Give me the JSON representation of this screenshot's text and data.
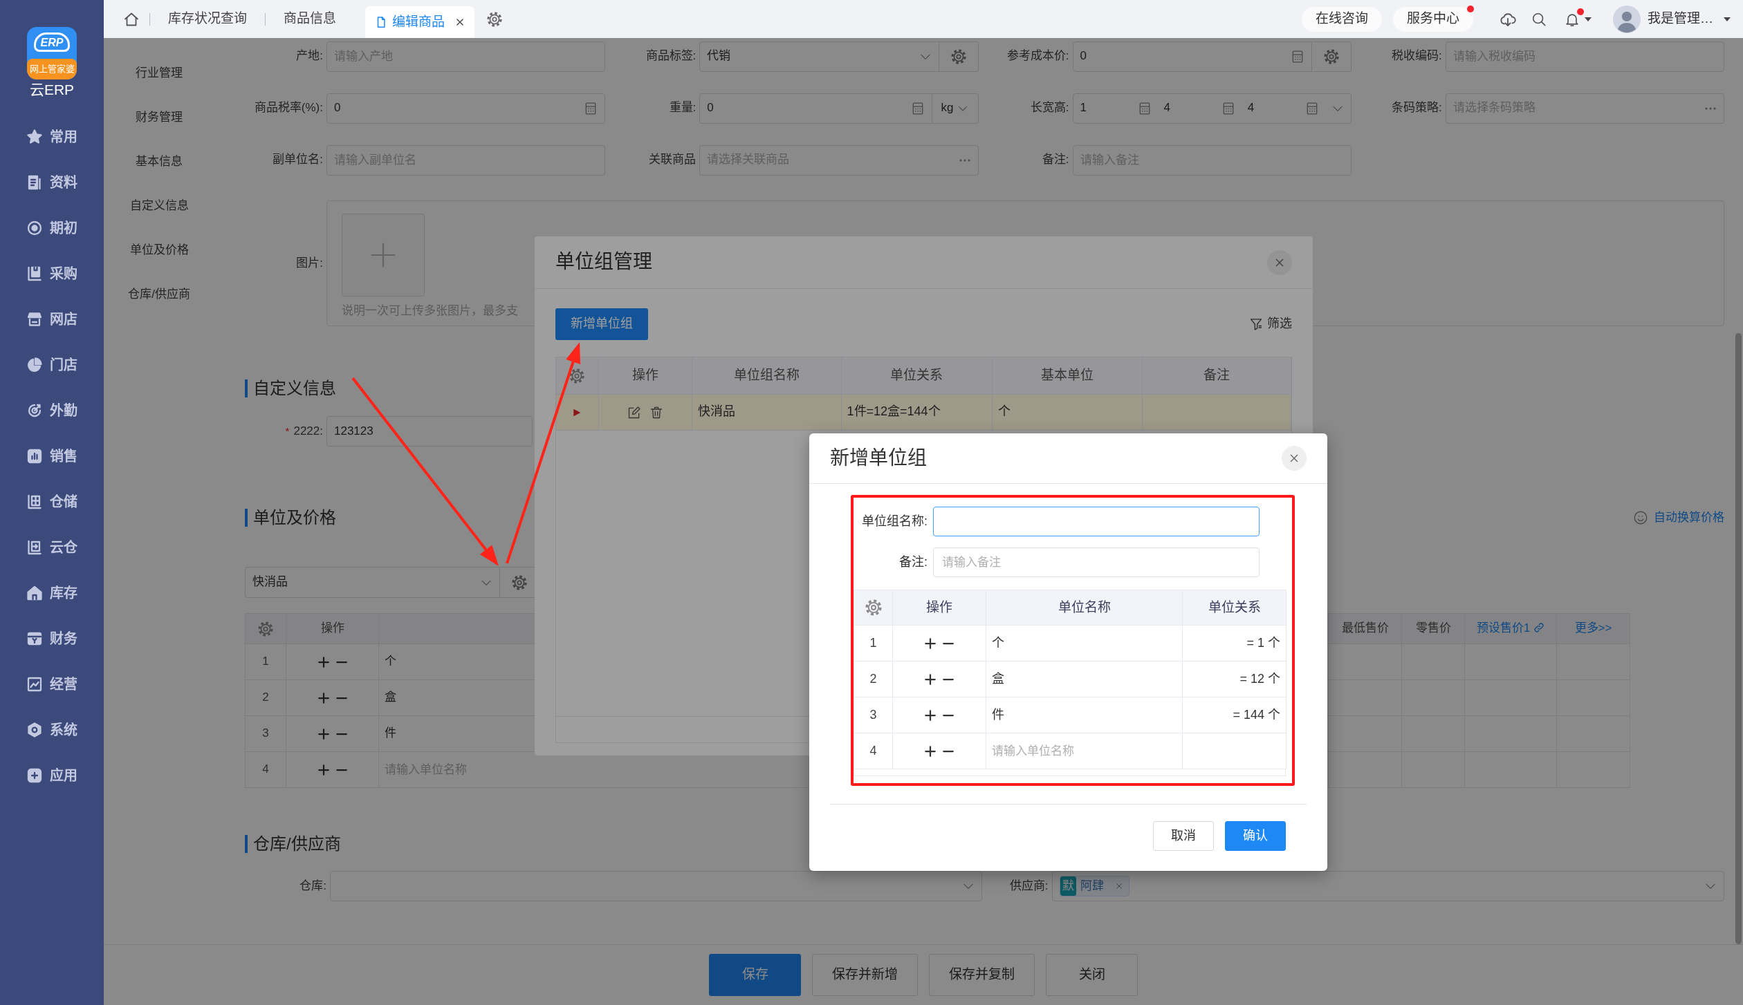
{
  "sidebar": {
    "logo_mark": "ERP",
    "logo_badge": "网上管家婆",
    "brand": "云ERP",
    "items": [
      "常用",
      "资料",
      "期初",
      "采购",
      "网店",
      "门店",
      "外勤",
      "销售",
      "仓储",
      "云仓",
      "库存",
      "财务",
      "经营",
      "系统",
      "应用"
    ]
  },
  "topbar": {
    "tabs": [
      {
        "label": "库存状况查询",
        "selected": false
      },
      {
        "label": "商品信息",
        "selected": false
      },
      {
        "label": "编辑商品",
        "selected": true
      }
    ],
    "actions": [
      {
        "label": "在线咨询",
        "dot": false
      },
      {
        "label": "服务中心",
        "dot": true
      }
    ],
    "bell_dot": true,
    "user_name": "我是管理…"
  },
  "section_nav": [
    "行业管理",
    "财务管理",
    "基本信息",
    "自定义信息",
    "单位及价格",
    "仓库/供应商"
  ],
  "form": {
    "rows": [
      [
        {
          "kind": "text",
          "label": "产地:",
          "placeholder": "请输入产地"
        },
        {
          "kind": "select-config",
          "label": "商品标签:",
          "value": "代销"
        },
        {
          "kind": "number-config",
          "label": "参考成本价:",
          "value": "0"
        },
        {
          "kind": "text",
          "label": "税收编码:",
          "placeholder": "请输入税收编码"
        }
      ],
      [
        {
          "kind": "number",
          "label": "商品税率(%):",
          "value": "0"
        },
        {
          "kind": "weight",
          "label": "重量:",
          "value": "0",
          "unit": "kg"
        },
        {
          "kind": "dims",
          "label": "长宽高:",
          "values": [
            "1",
            "4",
            "4"
          ]
        },
        {
          "kind": "lookup",
          "label": "条码策略:",
          "placeholder": "请选择条码策略"
        }
      ],
      [
        {
          "kind": "text",
          "label": "副单位名:",
          "placeholder": "请输入副单位名"
        },
        {
          "kind": "lookup",
          "label": "关联商品",
          "placeholder": "请选择关联商品"
        },
        {
          "kind": "text",
          "label": "备注:",
          "placeholder": "请输入备注"
        }
      ]
    ],
    "picture": {
      "label": "图片:",
      "hint": "说明一次可上传多张图片，最多支"
    }
  },
  "custom_info": {
    "title": "自定义信息",
    "fields": [
      {
        "required_mark": "*",
        "label": "2222:",
        "value": "123123"
      }
    ]
  },
  "units_prices": {
    "title": "单位及价格",
    "auto_convert_link": "自动换算价格",
    "unit_group": "快消品",
    "columns_left": [
      "操作"
    ],
    "columns_right": [
      {
        "label": "最低售价",
        "kind": "text"
      },
      {
        "label": "零售价",
        "kind": "text"
      },
      {
        "label": "预设售价1",
        "kind": "link-icon"
      },
      {
        "label": "更多>>",
        "kind": "link"
      }
    ],
    "rows": [
      {
        "number": "1",
        "unit": "个"
      },
      {
        "number": "2",
        "unit": "盒"
      },
      {
        "number": "3",
        "unit": "件"
      },
      {
        "number": "4",
        "placeholder": "请输入单位名称"
      }
    ]
  },
  "warehouse_supplier": {
    "title": "仓库/供应商",
    "fields": [
      {
        "kind": "select",
        "label": "仓库:"
      },
      {
        "kind": "tags",
        "label": "供应商:",
        "tags": [
          {
            "badge": "默",
            "label": "阿肆"
          }
        ]
      }
    ]
  },
  "footer_buttons": [
    {
      "label": "保存",
      "primary": true
    },
    {
      "label": "保存并新增",
      "primary": false
    },
    {
      "label": "保存并复制",
      "primary": false
    },
    {
      "label": "关闭",
      "primary": false
    }
  ],
  "unit_group_dialog": {
    "title": "单位组管理",
    "add_button": "新增单位组",
    "filter": "筛选",
    "columns": [
      "操作",
      "单位组名称",
      "单位关系",
      "基本单位",
      "备注"
    ],
    "rows": [
      {
        "selected": true,
        "name": "快消品",
        "relation": "1件=12盒=144个",
        "base_unit": "个"
      }
    ]
  },
  "new_group_dialog": {
    "title": "新增单位组",
    "fields": [
      {
        "label": "单位组名称:",
        "focused": true
      },
      {
        "label": "备注:",
        "placeholder": "请输入备注",
        "focused": false
      }
    ],
    "columns": [
      "操作",
      "单位名称",
      "单位关系"
    ],
    "rows": [
      {
        "number": "1",
        "unit": "个",
        "relation": "= 1 个"
      },
      {
        "number": "2",
        "unit": "盒",
        "relation": "= 12 个"
      },
      {
        "number": "3",
        "unit": "件",
        "relation": "= 144 个"
      },
      {
        "number": "4",
        "placeholder": "请输入单位名称"
      }
    ],
    "buttons": [
      {
        "label": "取消",
        "primary": false
      },
      {
        "label": "确认",
        "primary": true
      }
    ]
  },
  "annotations": [
    {
      "kind": "arrow"
    },
    {
      "kind": "arrow"
    },
    {
      "kind": "frame"
    }
  ]
}
